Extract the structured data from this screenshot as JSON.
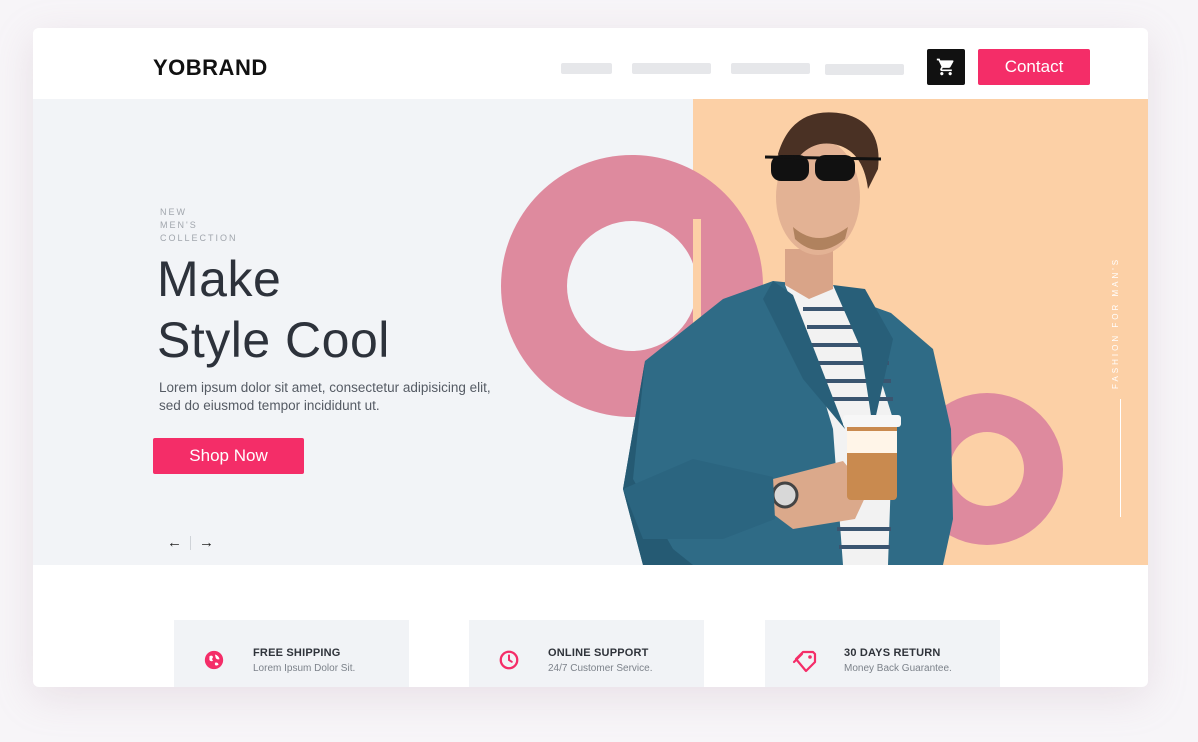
{
  "brand": {
    "name": "YOBRAND"
  },
  "header": {
    "contact_label": "Contact",
    "cart_icon": "cart-icon"
  },
  "hero": {
    "eyebrow": [
      "NEW",
      "MEN'S",
      "COLLECTION"
    ],
    "headline": [
      "Make",
      "Style Cool"
    ],
    "subtext": "Lorem ipsum dolor sit amet, consectetur adipisicing elit, sed do eiusmod tempor incididunt ut.",
    "cta_label": "Shop Now",
    "prev_arrow": "←",
    "next_arrow": "→",
    "vertical_text": "FASHION FOR MAN'S"
  },
  "features": [
    {
      "title": "FREE SHIPPING",
      "desc": "Lorem Ipsum Dolor Sit.",
      "icon": "globe-icon"
    },
    {
      "title": "ONLINE SUPPORT",
      "desc": "24/7 Customer Service.",
      "icon": "clock-icon"
    },
    {
      "title": "30 DAYS RETURN",
      "desc": "Money Back Guarantee.",
      "icon": "tag-icon"
    }
  ],
  "colors": {
    "accent": "#f42d68",
    "hero_bg": "#f2f4f7",
    "peach": "#fcd0a6",
    "ring": "#de8a9e",
    "text_dark": "#2d323b"
  }
}
